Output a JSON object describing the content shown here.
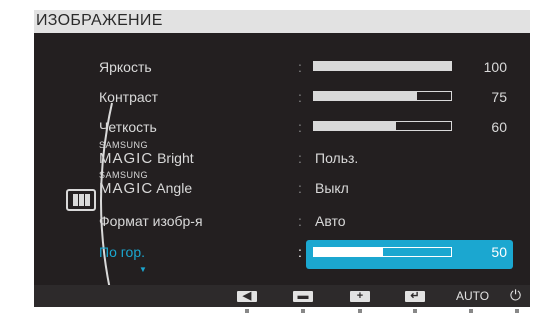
{
  "title": "ИЗОБРАЖЕНИЕ",
  "colors": {
    "accent": "#1ba7d0",
    "panel": "#231f20",
    "text": "#d9d9d9",
    "title_bar": "#e2e2e2"
  },
  "items": [
    {
      "label": "Яркость",
      "type": "slider",
      "value": 100,
      "value_text": "100"
    },
    {
      "label": "Контраст",
      "type": "slider",
      "value": 75,
      "value_text": "75"
    },
    {
      "label": "Четкость",
      "type": "slider",
      "value": 60,
      "value_text": "60"
    },
    {
      "brand": "SAMSUNG",
      "magic": "MAGIC",
      "label": "Bright",
      "type": "option",
      "value_text": "Польз."
    },
    {
      "brand": "SAMSUNG",
      "magic": "MAGIC",
      "label": "Angle",
      "type": "option",
      "value_text": "Выкл"
    },
    {
      "label": "Формат изобр-я",
      "type": "option",
      "value_text": "Авто"
    },
    {
      "label": "По гор.",
      "type": "slider",
      "value": 50,
      "value_text": "50",
      "selected": true
    }
  ],
  "colon": ":",
  "more_arrow": "▼",
  "bottom_bar": {
    "buttons": [
      {
        "icon": "left-arrow-icon",
        "glyph": "◀"
      },
      {
        "icon": "minus-icon",
        "glyph": "▬"
      },
      {
        "icon": "plus-icon",
        "glyph": "+"
      },
      {
        "icon": "enter-icon",
        "glyph": "↵"
      }
    ],
    "auto_label": "AUTO",
    "power_icon": "⏻"
  }
}
